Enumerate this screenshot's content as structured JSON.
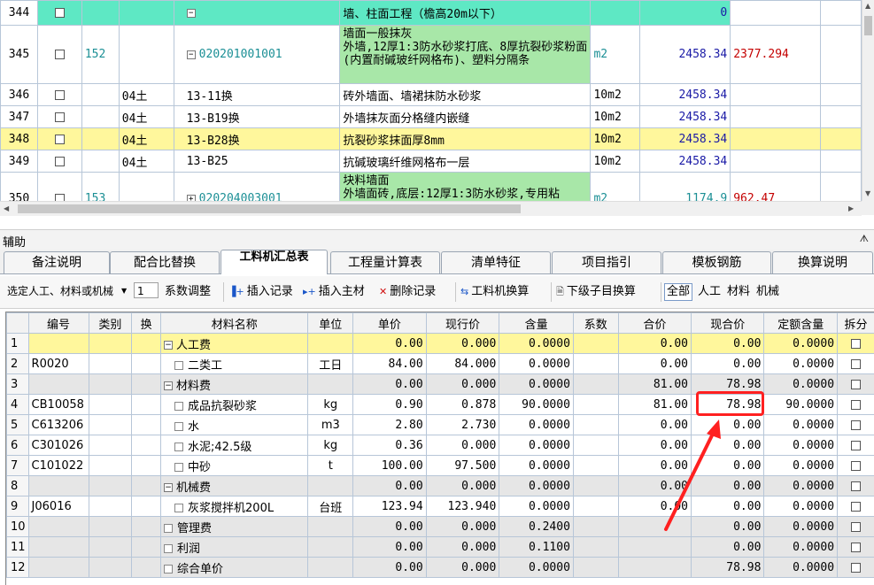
{
  "top_rows": [
    {
      "rn": "344",
      "seq": "",
      "type": "",
      "code": "",
      "name": "墙、柱面工程（檐高20m以下）",
      "unit": "",
      "qty": "0",
      "price": "",
      "style": "cyan",
      "expander": "⊟"
    },
    {
      "rn": "345",
      "seq": "152",
      "type": "",
      "code": "020201001001",
      "name": "墙面一般抹灰\n外墙,12厚1:3防水砂浆打底、8厚抗裂砂浆粉面(内置耐碱玻纤网格布)、塑料分隔条",
      "unit": "m2",
      "qty": "2458.34",
      "price": "2377.294",
      "style": "green",
      "expander": "⊟"
    },
    {
      "rn": "346",
      "seq": "",
      "type": "04土",
      "code": "13-11换",
      "name": "砖外墙面、墙裙抹防水砂浆",
      "unit": "10m2",
      "qty": "2458.34",
      "price": "",
      "style": "plain",
      "expander": ""
    },
    {
      "rn": "347",
      "seq": "",
      "type": "04土",
      "code": "13-B19换",
      "name": "外墙抹灰面分格缝内嵌缝",
      "unit": "10m2",
      "qty": "2458.34",
      "price": "",
      "style": "plain",
      "expander": ""
    },
    {
      "rn": "348",
      "seq": "",
      "type": "04土",
      "code": "13-B28换",
      "name": "抗裂砂浆抹面厚8mm",
      "unit": "10m2",
      "qty": "2458.34",
      "price": "",
      "style": "yellow",
      "expander": ""
    },
    {
      "rn": "349",
      "seq": "",
      "type": "04土",
      "code": "13-B25",
      "name": "抗碱玻璃纤维网格布一层",
      "unit": "10m2",
      "qty": "2458.34",
      "price": "",
      "style": "plain",
      "expander": ""
    },
    {
      "rn": "350",
      "seq": "153",
      "type": "",
      "code": "020204003001",
      "name": "块料墙面\n外墙面砖,底层:12厚1:3防水砂浆,专用粘",
      "unit": "m2",
      "qty": "1174.9",
      "price": "962.47",
      "style": "green",
      "expander": "⊞"
    }
  ],
  "panel": {
    "title": "辅助",
    "pin": "ᗑ"
  },
  "tabs": [
    "备注说明",
    "配合比替换",
    "工料机汇总表",
    "工程量计算表",
    "清单特征",
    "项目指引",
    "模板钢筋",
    "换算说明"
  ],
  "toolbar": {
    "select_label": "选定人工、材料或机械",
    "coef_value": "1",
    "coef_label": "系数调整",
    "insert_record": "插入记录",
    "insert_main": "插入主材",
    "delete_record": "删除记录",
    "labor_swap": "工料机换算",
    "child_swap": "下级子目换算",
    "filter_all": "全部",
    "filter_labor": "人工",
    "filter_material": "材料",
    "filter_machine": "机械"
  },
  "bottom_headers": [
    "",
    "编号",
    "类别",
    "换",
    "材料名称",
    "单位",
    "单价",
    "现行价",
    "含量",
    "系数",
    "合价",
    "现合价",
    "定额含量",
    "拆分"
  ],
  "bottom_rows": [
    {
      "rn": "1",
      "code": "",
      "cat": "",
      "swap": "",
      "name": "人工费",
      "group": true,
      "unit": "",
      "price": "0.00",
      "cur": "0.000",
      "qty": "0.0000",
      "coef": "",
      "total": "0.00",
      "curtotal": "0.00",
      "quota": "0.0000",
      "style": "yel"
    },
    {
      "rn": "2",
      "code": "R0020",
      "cat": "",
      "swap": "",
      "name": "二类工",
      "group": false,
      "unit": "工日",
      "price": "84.00",
      "cur": "84.000",
      "qty": "0.0000",
      "coef": "",
      "total": "0.00",
      "curtotal": "0.00",
      "quota": "0.0000",
      "style": "bg"
    },
    {
      "rn": "3",
      "code": "",
      "cat": "",
      "swap": "",
      "name": "材料费",
      "group": true,
      "unit": "",
      "price": "0.00",
      "cur": "0.000",
      "qty": "0.0000",
      "coef": "",
      "total": "81.00",
      "curtotal": "78.98",
      "quota": "0.0000",
      "style": "gray"
    },
    {
      "rn": "4",
      "code": "CB10058",
      "cat": "",
      "swap": "",
      "name": "成品抗裂砂浆",
      "group": false,
      "unit": "kg",
      "price": "0.90",
      "cur": "0.878",
      "qty": "90.0000",
      "coef": "",
      "total": "81.00",
      "curtotal": "78.98",
      "quota": "90.0000",
      "style": "bg"
    },
    {
      "rn": "5",
      "code": "C613206",
      "cat": "",
      "swap": "",
      "name": "水",
      "group": false,
      "unit": "m3",
      "price": "2.80",
      "cur": "2.730",
      "qty": "0.0000",
      "coef": "",
      "total": "0.00",
      "curtotal": "0.00",
      "quota": "0.0000",
      "style": "bg"
    },
    {
      "rn": "6",
      "code": "C301026",
      "cat": "",
      "swap": "",
      "name": "水泥;42.5级",
      "group": false,
      "unit": "kg",
      "price": "0.36",
      "cur": "0.000",
      "qty": "0.0000",
      "coef": "",
      "total": "0.00",
      "curtotal": "0.00",
      "quota": "0.0000",
      "style": "bg"
    },
    {
      "rn": "7",
      "code": "C101022",
      "cat": "",
      "swap": "",
      "name": "中砂",
      "group": false,
      "unit": "t",
      "price": "100.00",
      "cur": "97.500",
      "qty": "0.0000",
      "coef": "",
      "total": "0.00",
      "curtotal": "0.00",
      "quota": "0.0000",
      "style": "bg"
    },
    {
      "rn": "8",
      "code": "",
      "cat": "",
      "swap": "",
      "name": "机械费",
      "group": true,
      "unit": "",
      "price": "0.00",
      "cur": "0.000",
      "qty": "0.0000",
      "coef": "",
      "total": "0.00",
      "curtotal": "0.00",
      "quota": "0.0000",
      "style": "gray"
    },
    {
      "rn": "9",
      "code": "J06016",
      "cat": "",
      "swap": "",
      "name": "灰浆搅拌机200L",
      "group": false,
      "unit": "台班",
      "price": "123.94",
      "cur": "123.940",
      "qty": "0.0000",
      "coef": "",
      "total": "0.00",
      "curtotal": "0.00",
      "quota": "0.0000",
      "style": "bg"
    },
    {
      "rn": "10",
      "code": "",
      "cat": "",
      "swap": "",
      "name": "管理费",
      "group": "flat",
      "unit": "",
      "price": "0.00",
      "cur": "0.000",
      "qty": "0.2400",
      "coef": "",
      "total": "",
      "curtotal": "0.00",
      "quota": "0.0000",
      "style": "gray"
    },
    {
      "rn": "11",
      "code": "",
      "cat": "",
      "swap": "",
      "name": "利润",
      "group": "flat",
      "unit": "",
      "price": "0.00",
      "cur": "0.000",
      "qty": "0.1100",
      "coef": "",
      "total": "",
      "curtotal": "0.00",
      "quota": "0.0000",
      "style": "gray"
    },
    {
      "rn": "12",
      "code": "",
      "cat": "",
      "swap": "",
      "name": "综合单价",
      "group": "flat",
      "unit": "",
      "price": "0.00",
      "cur": "0.000",
      "qty": "0.0000",
      "coef": "",
      "total": "",
      "curtotal": "78.98",
      "quota": "0.0000",
      "style": "gray"
    }
  ],
  "colors": {
    "highlight": "#ff2020",
    "cyan_row": "#5ee8c4",
    "yellow_row": "#fff79c",
    "green_cell": "#a8e7a8"
  }
}
